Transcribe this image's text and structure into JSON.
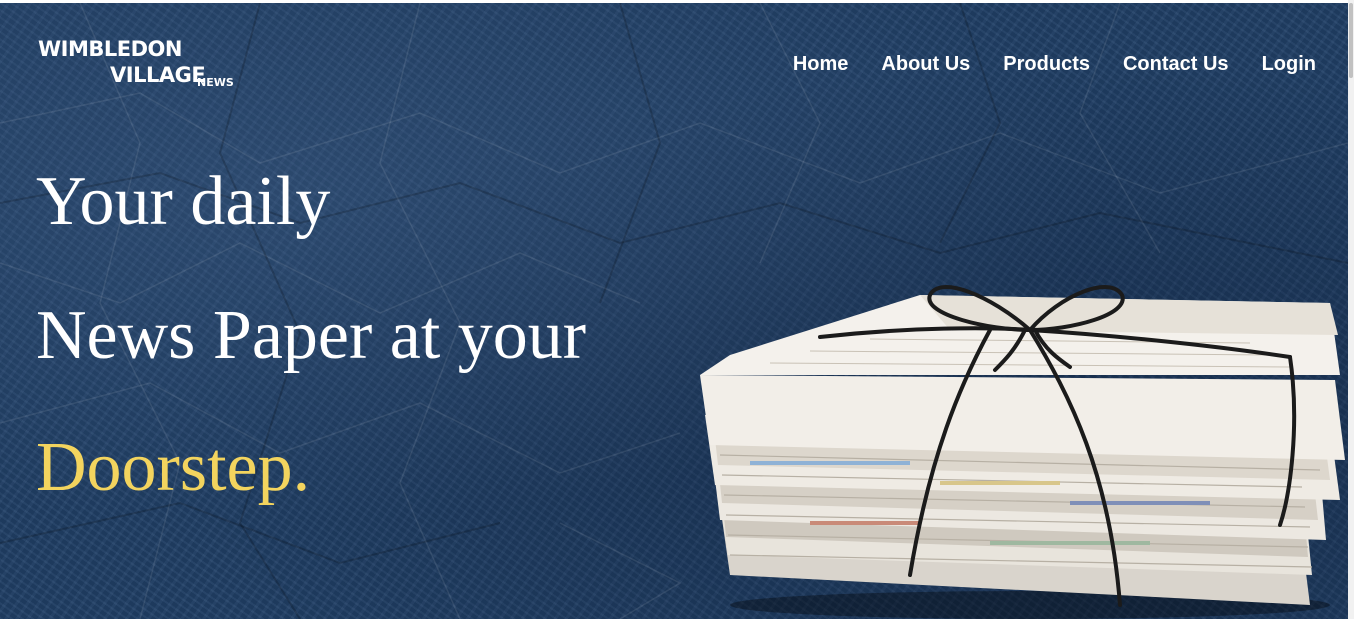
{
  "logo": {
    "line1": "WIMBLEDON",
    "line2": "VILLAGE",
    "line3": "NEWS"
  },
  "nav": {
    "items": [
      "Home",
      "About Us",
      "Products",
      "Contact Us",
      "Login"
    ]
  },
  "hero": {
    "line1": "Your daily",
    "line2": "News Paper at your",
    "line3": "Doorstep."
  },
  "colors": {
    "background": "#203f66",
    "accent": "#f3d45e",
    "text": "#ffffff"
  },
  "icons": {
    "hero_image": "newspaper-bundle-icon"
  }
}
